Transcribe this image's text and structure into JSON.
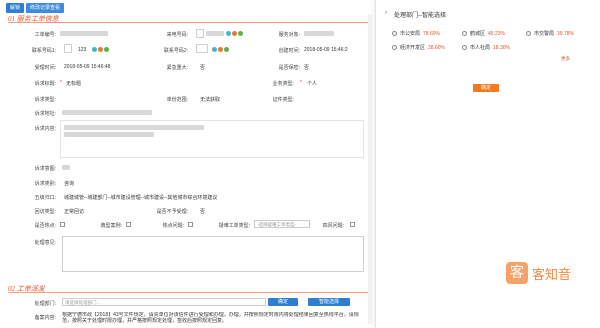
{
  "toolbar": {
    "btn1": "解锁",
    "btn2": "修改记录查看"
  },
  "section1": {
    "title": "01 服务工单信息"
  },
  "section2": {
    "title": "02 工单派发"
  },
  "form": {
    "order_no_label": "工单编号:",
    "caller_no_label": "来电号码:",
    "service_target_label": "服务对象:",
    "contact1_label": "联系号码1:",
    "contact1_value": "123",
    "contact2_label": "联系号码2:",
    "contact_addr_label": "联系地址:",
    "create_time_label": "创建时间:",
    "create_time_value": "2018-05-09 15:46:2",
    "accept_time_label": "受理时间:",
    "accept_time_value": "2018-05-09 15:46:48",
    "urgent_label": "紧急重大:",
    "urgent_value": "否",
    "confidential_label": "是否保密:",
    "confidential_value": "否",
    "req_title_label": "诉求标题:",
    "req_title_value": "无标题",
    "biz_type_label": "业务类型:",
    "biz_type_value": "个人",
    "req_type_label": "诉求类型:",
    "scope_label": "单份范围:",
    "scope_value": "无法获取",
    "cert_type_label": "证件类型:",
    "req_addr_label": "诉求地址:",
    "req_content_label": "诉求内容:",
    "req_purpose_label": "诉求意图:",
    "req_class_label": "诉求类别:",
    "req_class_value": "咨询",
    "category_label": "五级归口:",
    "category_value": "城建城管--城建部门--城市建设管理--城市建设--其他城市综合环境建议",
    "reply_type_label": "回访类型:",
    "reply_type_value": "正常回访",
    "not_accept_label": "是否不予受理:",
    "not_accept_value": "否",
    "hot_label": "是否热点:",
    "typical_label": "典型案例:",
    "hotline_label": "热点问题:",
    "special_label": "疑难工单类型:",
    "special_placeholder": "-选择疑难工单类型-",
    "four_label": "四风问题:",
    "opinion_label": "处理意见:"
  },
  "dispatch": {
    "dept_label": "处理部门:",
    "dept_placeholder": "请选择处理部门...",
    "confirm_btn": "确定",
    "smart_btn": "智能选择",
    "advice_label": "备案内容:",
    "advice_text": "根据宁德市政【2018】43号文件规定，请贵单位对该信件进行受理和办理，办理，并按照规定时限内将处理结果回复至热线平台，请规范，按照关于处理时限办理，并严格按照规定处理，签收后按照规定回复。"
  },
  "panel": {
    "title": "处理部门--智能选择",
    "options": [
      {
        "name": "市公安局",
        "pct": "78.60%"
      },
      {
        "name": "鹤城区",
        "pct": "45.23%"
      },
      {
        "name": "市交警局",
        "pct": "39.78%"
      },
      {
        "name": "经济开发区",
        "pct": "28.60%"
      },
      {
        "name": "市人社局",
        "pct": "18.30%"
      }
    ],
    "more": "更多",
    "confirm": "确定"
  },
  "logo": {
    "mark": "客",
    "text": "客知音"
  },
  "colors": {
    "accent": "#e8512a",
    "primary": "#2f7fd0",
    "confirm": "#f27a1e"
  }
}
